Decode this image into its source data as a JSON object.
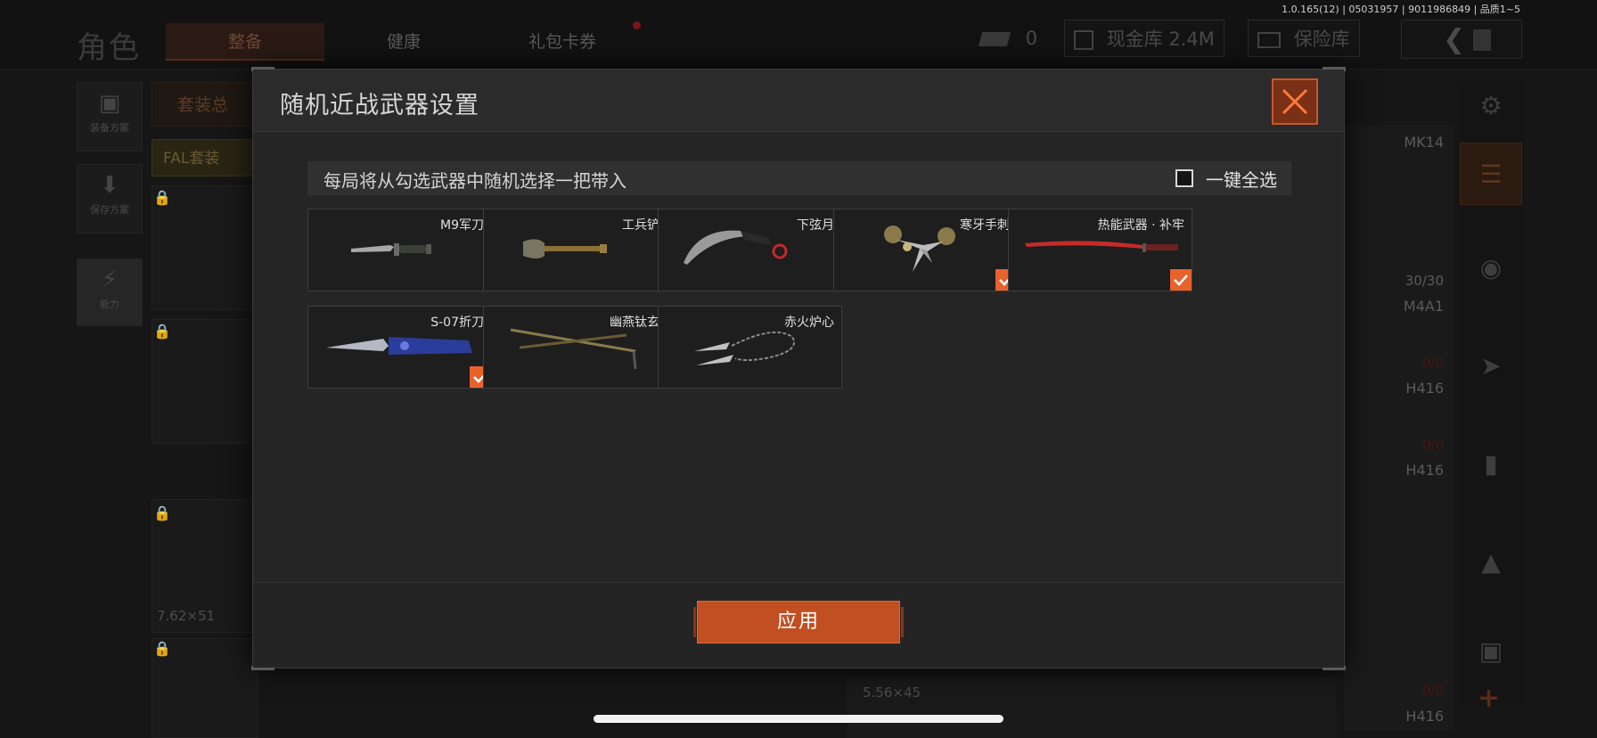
{
  "status": {
    "version": "1.0.165(12) | 05031957 | 9011986849 | 品质1~5"
  },
  "header": {
    "title": "角色",
    "tabs": [
      {
        "label": "整备",
        "active": true
      },
      {
        "label": "健康",
        "active": false
      },
      {
        "label": "礼包卡券",
        "active": false,
        "has_dot": true
      }
    ],
    "currency": [
      {
        "icon": "cash-stack-icon",
        "value": "0"
      },
      {
        "icon": "vault-icon",
        "value": "现金库 2.4M"
      },
      {
        "icon": "safe-icon",
        "value": "保险库"
      }
    ],
    "back_icon": "back-arrow-icon"
  },
  "left_panel": {
    "buttons": [
      {
        "icon": "vest-icon",
        "label": "装备方案"
      },
      {
        "icon": "download-icon",
        "label": "保存方案"
      },
      {
        "icon": "ability-icon",
        "label": "能力"
      }
    ],
    "suit_label": "套装总",
    "fal_label": "FAL套装",
    "caliber": "7.62×51"
  },
  "right_panel": {
    "weapons": [
      {
        "name": "MK14",
        "ammo": "30/30"
      },
      {
        "name": "M4A1",
        "ammo": "0/0"
      },
      {
        "name": "H416",
        "ammo": "0/0"
      },
      {
        "name": "H416",
        "ammo": ""
      }
    ],
    "bottom_caliber": "5.56×45",
    "bottom_ammo": "0/0",
    "bottom_name": "H416"
  },
  "modal": {
    "title": "随机近战武器设置",
    "instruction": "每局将从勾选武器中随机选择一把带入",
    "select_all_label": "一键全选",
    "select_all_checked": false,
    "weapons": [
      {
        "name": "M9军刀",
        "icon": "bayonet-knife-icon",
        "checked": false
      },
      {
        "name": "工兵铲",
        "icon": "shovel-icon",
        "checked": false
      },
      {
        "name": "下弦月",
        "icon": "karambit-icon",
        "checked": false
      },
      {
        "name": "寒牙手刺",
        "icon": "claw-dagger-icon",
        "checked": true
      },
      {
        "name": "热能武器 · 补牢",
        "icon": "katana-icon",
        "checked": true
      },
      {
        "name": "S-07折刀",
        "icon": "folding-knife-icon",
        "checked": true
      },
      {
        "name": "幽燕钛玄",
        "icon": "twin-spear-icon",
        "checked": false
      },
      {
        "name": "赤火炉心",
        "icon": "rope-dart-icon",
        "checked": false
      }
    ],
    "apply_label": "应用"
  },
  "colors": {
    "accent": "#c24f22",
    "check": "#e8622c",
    "modal_bg": "#252525"
  }
}
